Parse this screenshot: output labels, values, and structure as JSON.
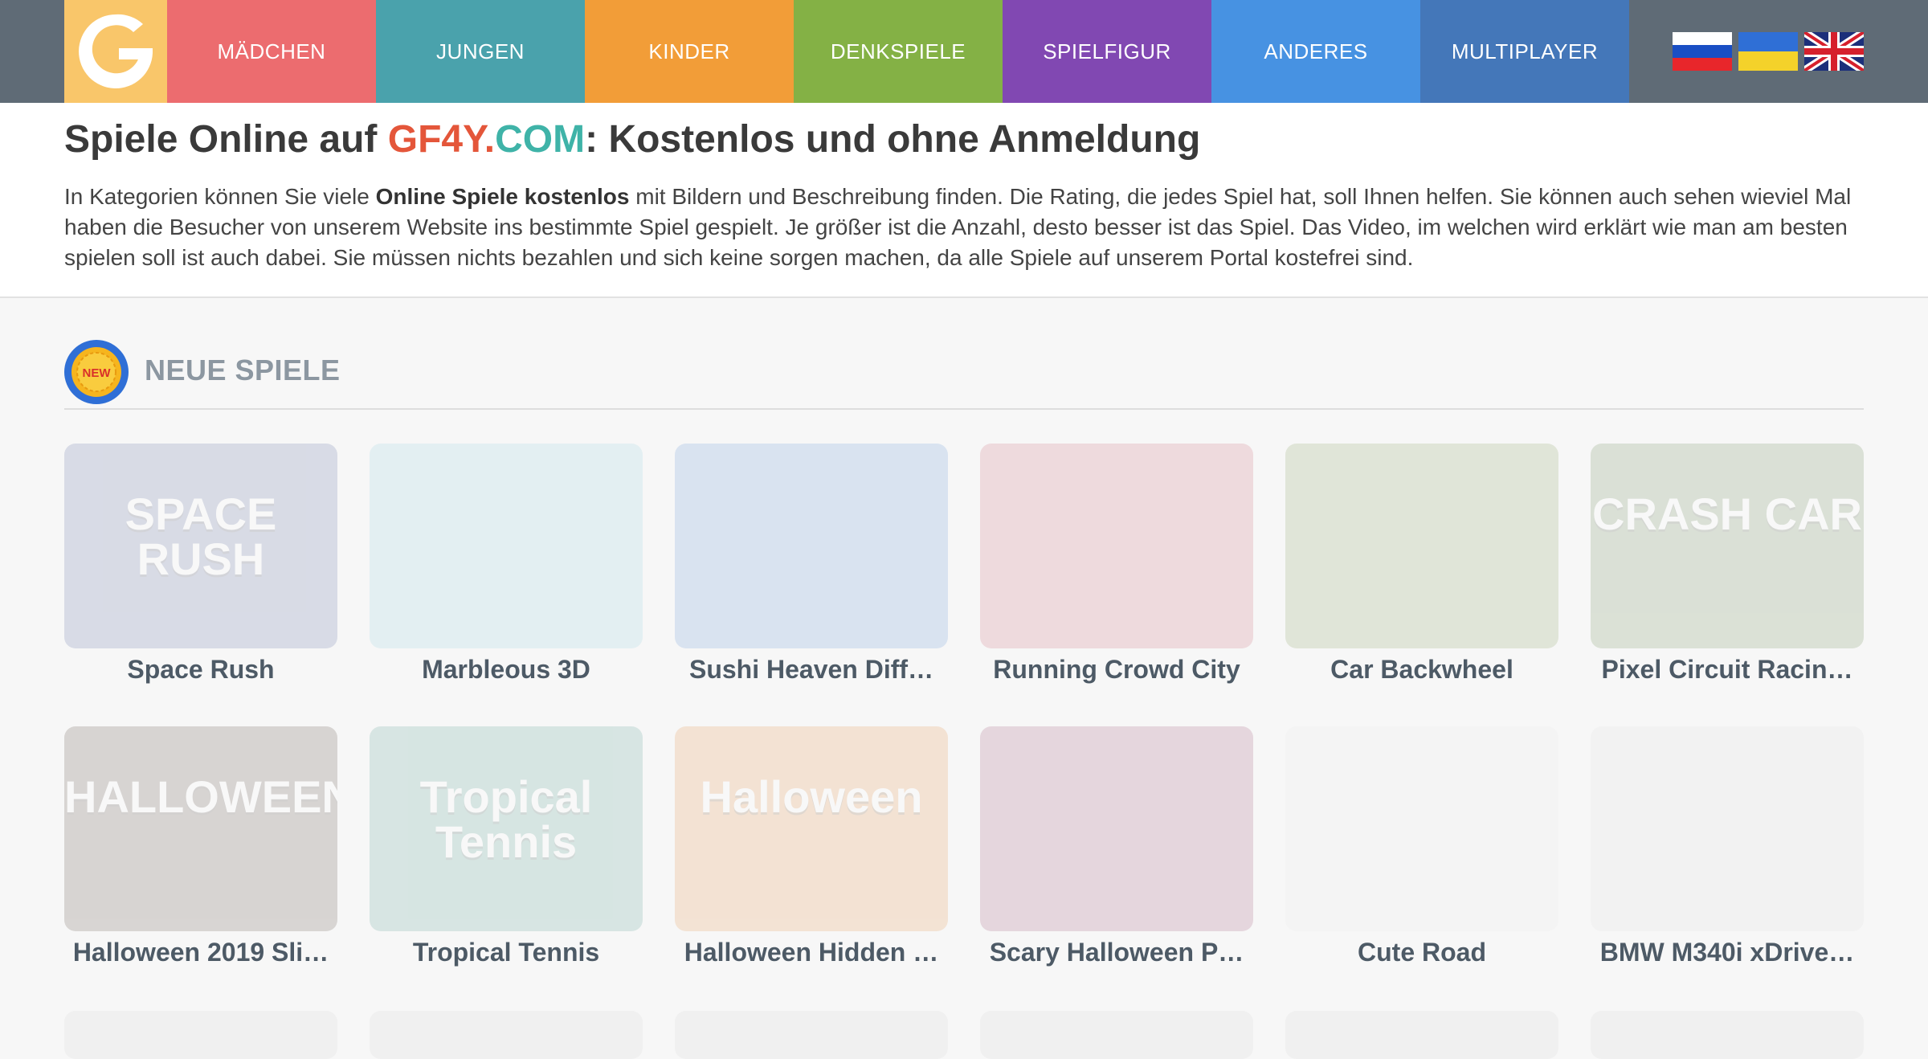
{
  "header": {
    "logo_icon": "gf4y-logo-icon",
    "nav": [
      {
        "label": "MÄDCHEN",
        "color": "#ec6c6f"
      },
      {
        "label": "JUNGEN",
        "color": "#4aa2ac"
      },
      {
        "label": "KINDER",
        "color": "#f29d38"
      },
      {
        "label": "DENKSPIELE",
        "color": "#84b145"
      },
      {
        "label": "SPIELFIGUR",
        "color": "#8148b2"
      },
      {
        "label": "ANDERES",
        "color": "#4792e2"
      },
      {
        "label": "MULTIPLAYER",
        "color": "#4477b9"
      }
    ],
    "flags": [
      "russian-flag-icon",
      "ukrainian-flag-icon",
      "uk-flag-icon"
    ]
  },
  "intro": {
    "title_prefix": "Spiele Online auf ",
    "title_brand_1": "GF4Y.",
    "title_brand_2": "COM",
    "title_suffix": ": Kostenlos und ohne Anmeldung",
    "text_1": "In Kategorien können Sie viele ",
    "text_bold": "Online Spiele kostenlos",
    "text_2": " mit Bildern und Beschreibung finden. Die Rating, die jedes Spiel hat, soll Ihnen helfen. Sie können auch sehen wieviel Mal haben die Besucher von unserem Website ins bestimmte Spiel gespielt. Je größer ist die Anzahl, desto besser ist das Spiel. Das Video, im welchen wird erklärt wie man am besten spielen soll ist auch dabei. Sie müssen nichts bezahlen und sich keine sorgen machen, da alle Spiele auf unserem Portal kostefrei sind."
  },
  "section": {
    "badge_label": "NEW",
    "title": "NEUE SPIELE"
  },
  "games": [
    {
      "title": "Space Rush",
      "thumb_text": "SPACE RUSH",
      "bg": "#3b4d8c"
    },
    {
      "title": "Marbleous 3D",
      "thumb_text": "",
      "bg": "#7fc8d8"
    },
    {
      "title": "Sushi Heaven Diff…",
      "thumb_text": "",
      "bg": "#3d7fd0"
    },
    {
      "title": "Running Crowd City",
      "thumb_text": "",
      "bg": "#c0455a"
    },
    {
      "title": "Car Backwheel",
      "thumb_text": "",
      "bg": "#6b8a3a"
    },
    {
      "title": "Pixel Circuit Racin…",
      "thumb_text": "CRASH CAR",
      "bg": "#4a6f2e"
    },
    {
      "title": "Halloween 2019 Sli…",
      "thumb_text": "HALLOWEEN",
      "bg": "#3a2418"
    },
    {
      "title": "Tropical Tennis",
      "thumb_text": "Tropical Tennis",
      "bg": "#2f8a7a"
    },
    {
      "title": "Halloween Hidden …",
      "thumb_text": "Halloween",
      "bg": "#e07a1f"
    },
    {
      "title": "Scary Halloween P…",
      "thumb_text": "",
      "bg": "#8a2a5a"
    },
    {
      "title": "Cute Road",
      "thumb_text": "",
      "bg": "#e8e8e8"
    },
    {
      "title": "BMW M340i xDrive…",
      "thumb_text": "",
      "bg": "#d8d8d8"
    }
  ]
}
